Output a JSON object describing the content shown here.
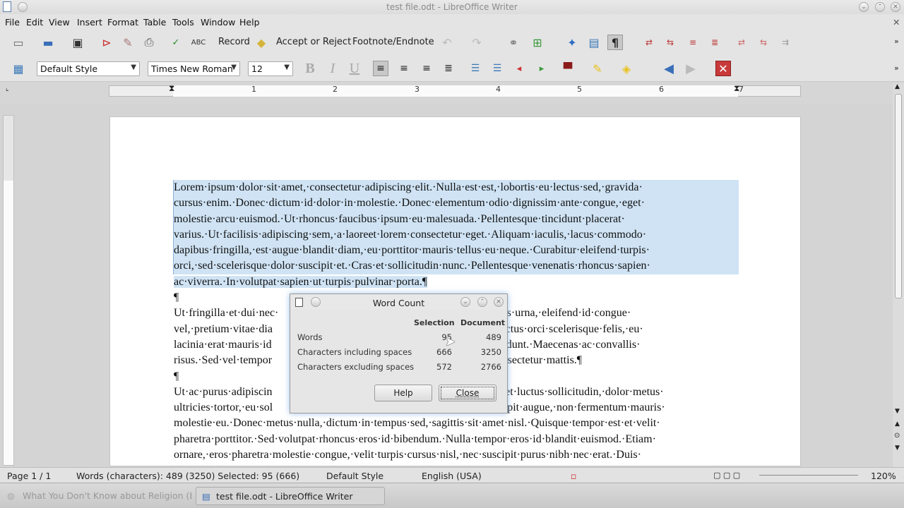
{
  "window": {
    "title": "test file.odt - LibreOffice Writer"
  },
  "menu": [
    "File",
    "Edit",
    "View",
    "Insert",
    "Format",
    "Table",
    "Tools",
    "Window",
    "Help"
  ],
  "toolbar1": {
    "record": "Record",
    "accept_reject": "Accept or Reject",
    "footnote": "Footnote/Endnote"
  },
  "toolbar2": {
    "style": "Default Style",
    "font": "Times New Roman",
    "size": "12"
  },
  "ruler": [
    "1",
    "2",
    "3",
    "4",
    "5",
    "6",
    "7"
  ],
  "document": {
    "para1": [
      "Lorem·ipsum·dolor·sit·amet,·consectetur·adipiscing·elit.·Nulla·est·est,·lobortis·eu·lectus·sed,·gravida·",
      "cursus·enim.·Donec·dictum·id·dolor·in·molestie.·Donec·elementum·odio·dignissim·ante·congue,·eget·",
      "molestie·arcu·euismod.·Ut·rhoncus·faucibus·ipsum·eu·malesuada.·Pellentesque·tincidunt·placerat·",
      "varius.·Ut·facilisis·adipiscing·sem,·a·laoreet·lorem·consectetur·eget.·Aliquam·iaculis,·lacus·commodo·",
      "dapibus·fringilla,·est·augue·blandit·diam,·eu·porttitor·mauris·tellus·eu·neque.·Curabitur·eleifend·turpis·",
      "orci,·sed·scelerisque·dolor·suscipit·et.·Cras·et·sollicitudin·nunc.·Pellentesque·venenatis·rhoncus·sapien·",
      "ac·viverra.·In·volutpat·sapien·ut·turpis·pulvinar·porta.¶"
    ],
    "pilcrow": "¶",
    "para2": [
      "Ut·fringilla·et·dui·nec·",
      "vel,·pretium·vitae·dia",
      "lacinia·erat·mauris·id",
      "risus.·Sed·vel·tempor"
    ],
    "para2r": [
      "Curabitur·lacus·urna,·eleifend·id·congue·",
      "·eleifend,·lectus·orci·scelerisque·felis,·eu·",
      "isis·tincidunt.·Maecenas·ac·convallis·",
      "ongue·consectetur·mattis.¶"
    ],
    "para3": [
      "Ut·ac·purus·adipiscin",
      "ultricies·tortor,·eu·sol",
      "molestie·eu.·Donec·metus·nulla,·dictum·in·tempus·sed,·sagittis·sit·amet·nisl.·Quisque·tempor·est·et·velit·",
      "pharetra·porttitor.·Sed·volutpat·rhoncus·eros·id·bibendum.·Nulla·tempor·eros·id·blandit·euismod.·Etiam·",
      "ornare,·eros·pharetra·molestie·congue,·velit·turpis·cursus·nisl,·nec·suscipit·purus·nibh·nec·erat.·Duis·"
    ],
    "para3r": [
      "us·eget·luctus·sollicitudin,·dolor·metus·",
      "is·suscipit·augue,·non·fermentum·mauris·"
    ]
  },
  "dialog": {
    "title": "Word Count",
    "col_selection": "Selection",
    "col_document": "Document",
    "rows": [
      {
        "label": "Words",
        "sel": "95",
        "doc": "489"
      },
      {
        "label": "Characters including spaces",
        "sel": "666",
        "doc": "3250"
      },
      {
        "label": "Characters excluding spaces",
        "sel": "572",
        "doc": "2766"
      }
    ],
    "help": "Help",
    "close": "Close"
  },
  "status": {
    "page": "Page 1 / 1",
    "words": "Words (characters): 489 (3250) Selected: 95 (666)",
    "style": "Default Style",
    "lang": "English (USA)",
    "zoom": "120%"
  },
  "taskbar": [
    {
      "label": "What You Don't Know about Religion (but S"
    },
    {
      "label": "test file.odt - LibreOffice Writer"
    }
  ]
}
